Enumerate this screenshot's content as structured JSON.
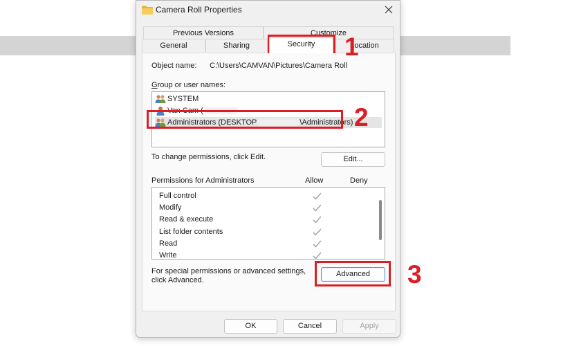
{
  "window": {
    "title": "Camera Roll Properties"
  },
  "tabs": {
    "row1": [
      {
        "label": "Previous Versions"
      },
      {
        "label": "Customize"
      }
    ],
    "row2": [
      {
        "label": "General"
      },
      {
        "label": "Sharing"
      },
      {
        "label": "Security",
        "active": true
      },
      {
        "label": "Location"
      }
    ]
  },
  "object": {
    "label": "Object name:",
    "value": "C:\\Users\\CAMVAN\\Pictures\\Camera Roll"
  },
  "groups": {
    "label": "Group or user names:",
    "items": [
      {
        "label": "SYSTEM",
        "icon": "users-group-icon"
      },
      {
        "label": "Van Cam (",
        "icon": "user-icon"
      },
      {
        "label_prefix": "Administrators (DESKTOP",
        "label_suffix": "\\Administrators)",
        "icon": "users-group-icon",
        "selected": true
      }
    ]
  },
  "change_hint": "To change permissions, click Edit.",
  "edit_button": "Edit...",
  "permissions": {
    "label": "Permissions for Administrators",
    "allow_label": "Allow",
    "deny_label": "Deny",
    "rows": [
      {
        "label": "Full control",
        "allow": true
      },
      {
        "label": "Modify",
        "allow": true
      },
      {
        "label": "Read & execute",
        "allow": true
      },
      {
        "label": "List folder contents",
        "allow": true
      },
      {
        "label": "Read",
        "allow": true
      },
      {
        "label": "Write",
        "allow": true
      }
    ]
  },
  "special": {
    "line1": "For special permissions or advanced settings,",
    "line2": "click Advanced."
  },
  "advanced_button": "Advanced",
  "footer": {
    "ok": "OK",
    "cancel": "Cancel",
    "apply": "Apply"
  },
  "callouts": [
    "1",
    "2",
    "3"
  ],
  "colors": {
    "callout_red": "#dd1c24",
    "accent_blue": "#5c8ed2",
    "check_grey": "#a8a8a8"
  }
}
